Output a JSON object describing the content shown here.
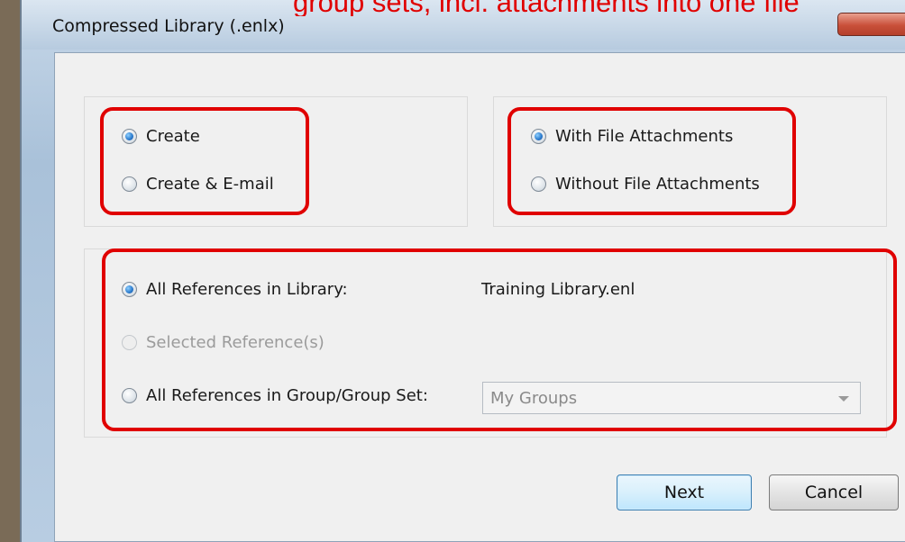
{
  "window": {
    "title": "Compressed Library (.enlx)"
  },
  "annotation": {
    "text": "group sets, incl. attachments into one file"
  },
  "mode": {
    "create_label": "Create",
    "create_email_label": "Create & E-mail",
    "selected": "Create"
  },
  "attachments": {
    "with_label": "With File Attachments",
    "without_label": "Without File Attachments",
    "selected": "With File Attachments"
  },
  "scope": {
    "all_label": "All References in Library:",
    "library_name": "Training Library.enl",
    "selected_refs_label": "Selected Reference(s)",
    "group_label": "All References in Group/Group Set:",
    "group_combo_value": "My Groups",
    "selected": "All References in Library:"
  },
  "buttons": {
    "next_label": "Next",
    "cancel_label": "Cancel"
  },
  "colors": {
    "highlight": "#e00000",
    "radio_on": "#2f7fd0"
  }
}
